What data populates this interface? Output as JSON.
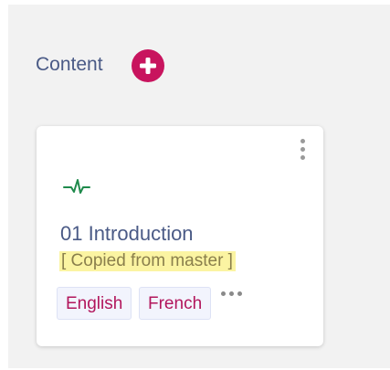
{
  "section": {
    "title": "Content"
  },
  "card": {
    "title": "01 Introduction",
    "copied_note": "[ Copied from master ]",
    "languages": [
      "English",
      "French"
    ]
  },
  "icons": {
    "add": "plus-circle-icon",
    "options": "kebab-menu-icon",
    "activity": "pulse-icon",
    "more": "more-horizontal-icon"
  },
  "colors": {
    "accent": "#c8145e",
    "title_text": "#4a5a86",
    "activity_icon": "#1f8a4c",
    "language_text": "#b2165c",
    "highlight": "#fbf4a2"
  }
}
